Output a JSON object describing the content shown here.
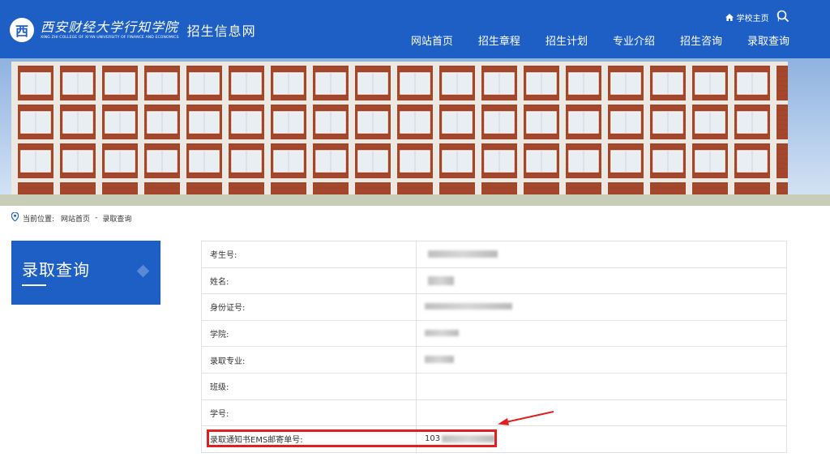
{
  "header": {
    "logo_emblem": "西",
    "school_name_cn": "西安财经大学行知学院",
    "school_name_en": "XING ZHI COLLEGE OF XI'AN UNIVERSITY OF FINANCE AND ECONOMICS",
    "site_name": "招生信息网",
    "school_home_label": "学校主页",
    "top_separator": "|",
    "icons": {
      "home": "home-icon",
      "search": "search-icon"
    }
  },
  "nav": {
    "items": [
      "网站首页",
      "招生章程",
      "招生计划",
      "专业介绍",
      "招生咨询",
      "录取查询"
    ]
  },
  "breadcrumb": {
    "prefix": "当前位置:",
    "items": [
      "网站首页",
      "录取查询"
    ],
    "separator": "-"
  },
  "sidebar": {
    "title": "录取查询"
  },
  "result_table": {
    "rows": [
      {
        "label": "考生号:",
        "value": ""
      },
      {
        "label": "姓名:",
        "value": ""
      },
      {
        "label": "身份证号:",
        "value": ""
      },
      {
        "label": "学院:",
        "value": ""
      },
      {
        "label": "录取专业:",
        "value": ""
      },
      {
        "label": "班级:",
        "value": ""
      },
      {
        "label": "学号:",
        "value": ""
      },
      {
        "label": "录取通知书EMS邮寄单号:",
        "value": "103"
      }
    ]
  },
  "colors": {
    "brand_blue": "#1d5fc4",
    "highlight_red": "#e02020"
  }
}
